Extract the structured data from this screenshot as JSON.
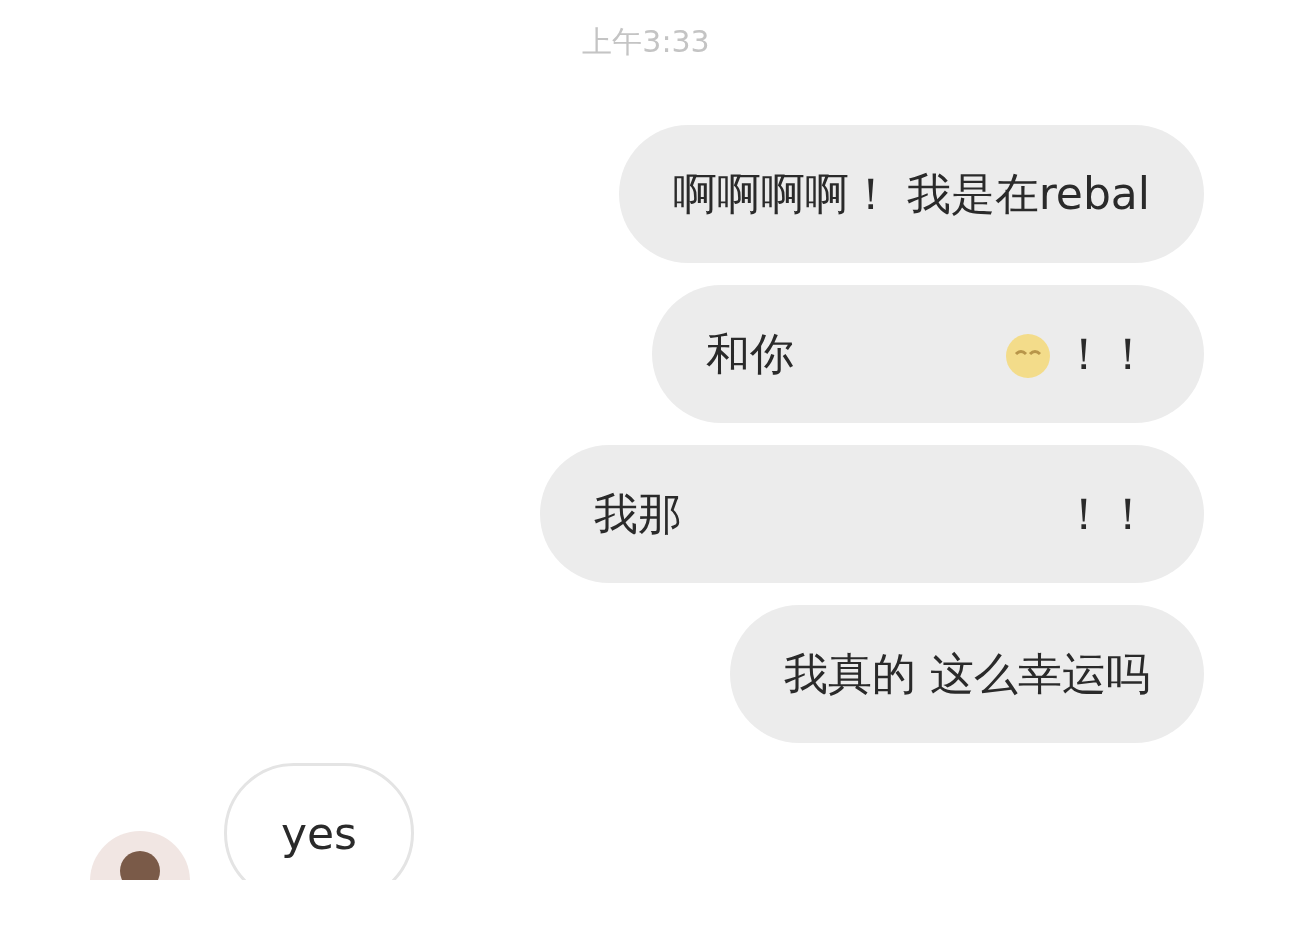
{
  "timestamp": "上午3:33",
  "messages": [
    {
      "kind": "outgoing",
      "segments": [
        {
          "kind": "text",
          "text": "啊啊啊啊！ 我是在rebal"
        }
      ]
    },
    {
      "kind": "outgoing",
      "segments": [
        {
          "kind": "text",
          "text": "和你"
        },
        {
          "kind": "erased"
        },
        {
          "kind": "emoji"
        },
        {
          "kind": "text",
          "text": "！！"
        }
      ]
    },
    {
      "kind": "outgoing",
      "segments": [
        {
          "kind": "text",
          "text": "我那"
        },
        {
          "kind": "erased"
        },
        {
          "kind": "text",
          "text": "！！"
        }
      ]
    },
    {
      "kind": "outgoing",
      "segments": [
        {
          "kind": "text",
          "text": "我真的 这么幸运吗"
        }
      ]
    },
    {
      "kind": "incoming",
      "segments": [
        {
          "kind": "text",
          "text": "yes"
        }
      ]
    }
  ]
}
